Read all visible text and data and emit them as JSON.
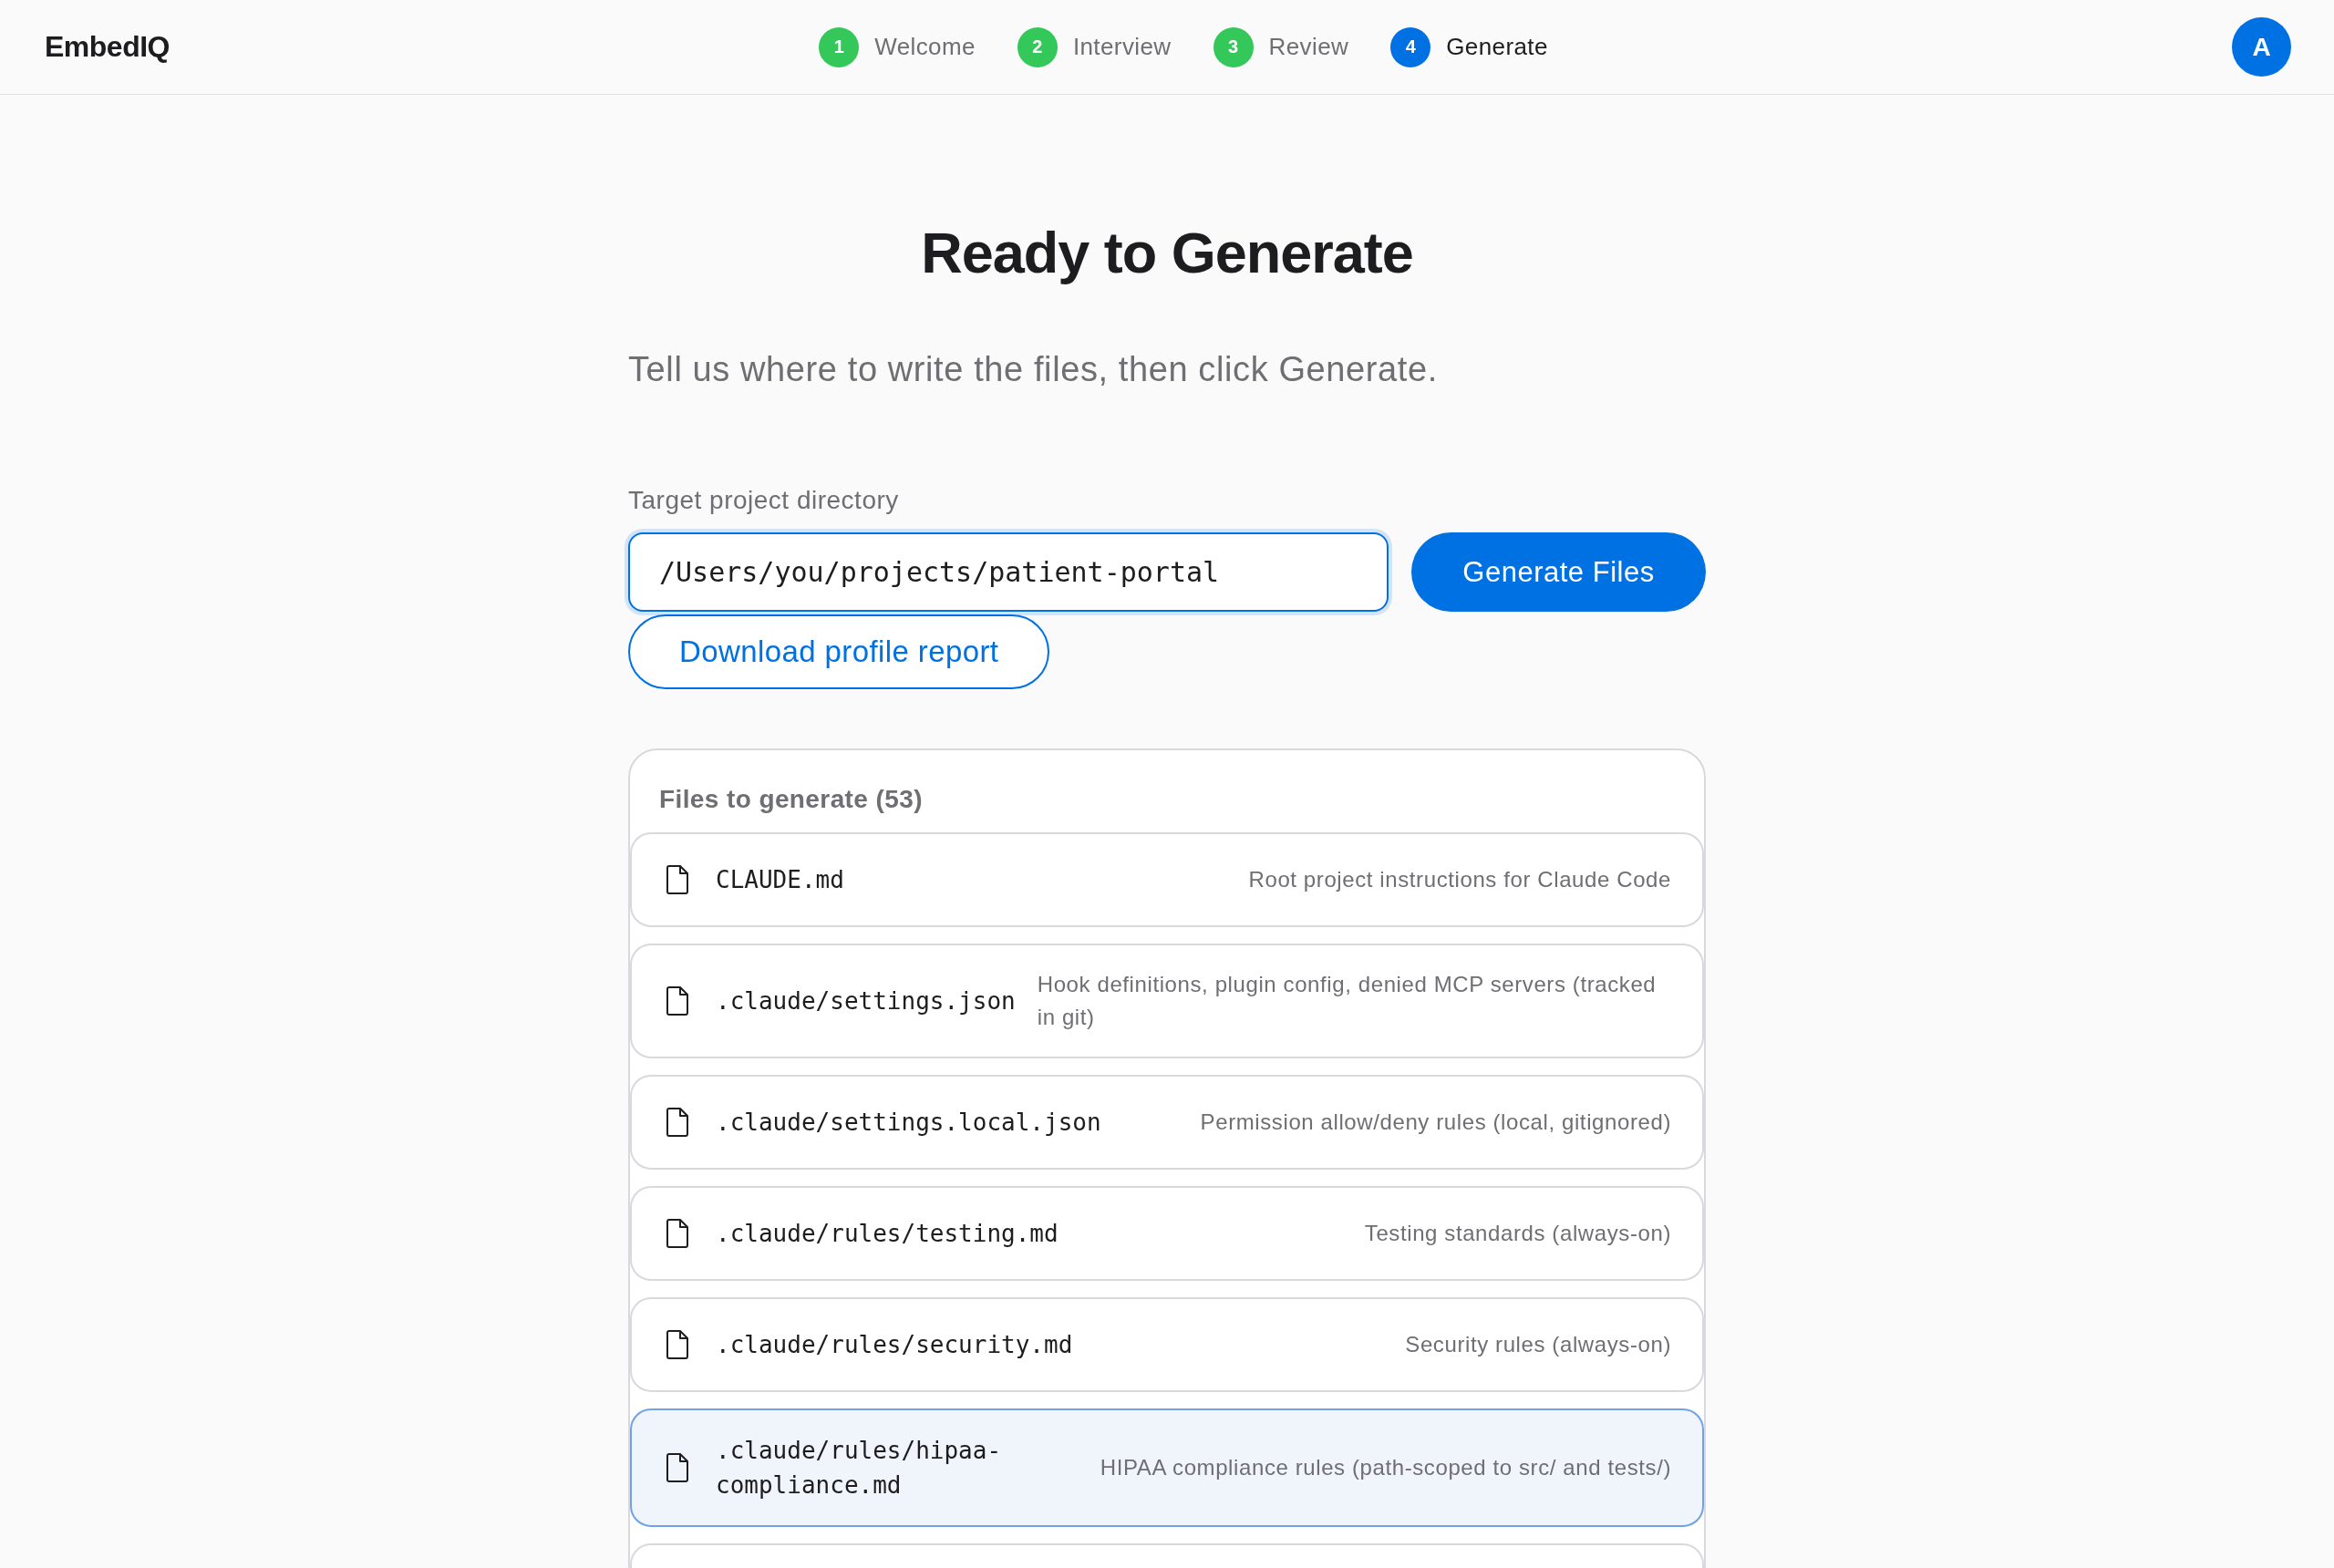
{
  "app": {
    "logo": "EmbedIQ",
    "avatar": "A"
  },
  "steps": [
    {
      "number": "1",
      "label": "Welcome",
      "completed": true,
      "current": false
    },
    {
      "number": "2",
      "label": "Interview",
      "completed": true,
      "current": false
    },
    {
      "number": "3",
      "label": "Review",
      "completed": true,
      "current": false
    },
    {
      "number": "4",
      "label": "Generate",
      "completed": false,
      "current": true
    }
  ],
  "page": {
    "title": "Ready to Generate",
    "subtitle": "Tell us where to write the files, then click Generate."
  },
  "target": {
    "label": "Target project directory",
    "value": "/Users/you/projects/patient-portal",
    "focused": true
  },
  "buttons": {
    "generate": "Generate Files",
    "download": "Download profile report"
  },
  "files_panel": {
    "title": "Files to generate (53)",
    "files": [
      {
        "name": "CLAUDE.md",
        "description": "Root project instructions for Claude Code",
        "selected": false
      },
      {
        "name": ".claude/settings.json",
        "description": "Hook definitions, plugin config, denied MCP servers (tracked in git)",
        "selected": false
      },
      {
        "name": ".claude/settings.local.json",
        "description": "Permission allow/deny rules (local, gitignored)",
        "selected": false
      },
      {
        "name": ".claude/rules/testing.md",
        "description": "Testing standards (always-on)",
        "selected": false
      },
      {
        "name": ".claude/rules/security.md",
        "description": "Security rules (always-on)",
        "selected": false
      },
      {
        "name": ".claude/rules/hipaa-compliance.md",
        "description": "HIPAA compliance rules (path-scoped to src/ and tests/)",
        "selected": true
      }
    ]
  }
}
